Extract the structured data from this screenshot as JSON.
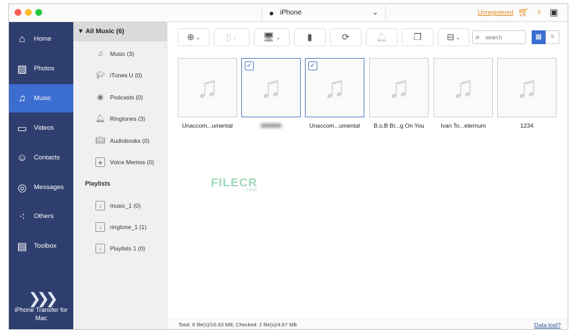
{
  "titlebar": {
    "device": "iPhone",
    "unregistered": "Unregistered"
  },
  "sidebar": {
    "items": [
      {
        "label": "Home",
        "icon": "home-icon",
        "glyph": "⌂"
      },
      {
        "label": "Photos",
        "icon": "photos-icon",
        "glyph": "▨"
      },
      {
        "label": "Music",
        "icon": "music-icon",
        "glyph": "♫"
      },
      {
        "label": "Videos",
        "icon": "videos-icon",
        "glyph": "▭"
      },
      {
        "label": "Contacts",
        "icon": "contacts-icon",
        "glyph": "👥"
      },
      {
        "label": "Messages",
        "icon": "messages-icon",
        "glyph": "◎"
      },
      {
        "label": "Others",
        "icon": "others-icon",
        "glyph": "⁖"
      },
      {
        "label": "Toolbox",
        "icon": "toolbox-icon",
        "glyph": "▤"
      }
    ],
    "active": "Music",
    "brand": {
      "line1": "iPhone Transfer for",
      "line2": "Mac"
    }
  },
  "subpanel": {
    "all_music": "▼ All Music (6)",
    "categories": [
      "Music (3)",
      "iTunes U (0)",
      "Podcasts (0)",
      "Ringtones (3)",
      "Audiobooks (0)",
      "Voice Memos (0)"
    ],
    "playlists_header": "Playlists",
    "playlists": [
      "music_1 (0)",
      "ringtone_1 (1)",
      "Playlists 1 (0)"
    ]
  },
  "search": {
    "placeholder": "search"
  },
  "files": [
    {
      "name": "Unaccom...umental",
      "checked": false
    },
    {
      "name": "",
      "checked": true,
      "blurred": true
    },
    {
      "name": "Unaccom...umental",
      "checked": true
    },
    {
      "name": "B.o.B Br...g On You",
      "checked": false
    },
    {
      "name": "Ivan To...eternum",
      "checked": false
    },
    {
      "name": "1234",
      "checked": false
    }
  ],
  "status": {
    "summary": "Total: 6 file(s)/16.93 MB; Checked: 2 file(s)/4.67 MB",
    "data_lost": "Data lost?"
  },
  "watermark": {
    "text": "FILECR",
    "sub": ".com"
  },
  "colors": {
    "sidebar": "#2e3e6e",
    "active": "#3c6dd0",
    "accent": "#e08a1e"
  }
}
